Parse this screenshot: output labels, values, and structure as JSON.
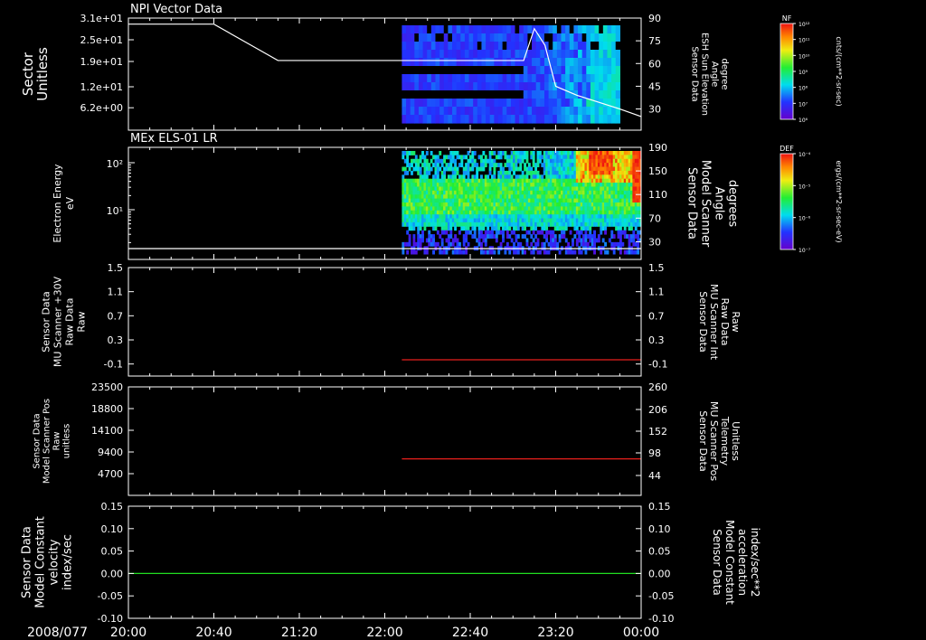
{
  "chart_data": [
    {
      "type": "heatmap",
      "title": "NPI Vector Data",
      "ylabel": [
        "Sector",
        "Unitless"
      ],
      "yticks": [
        "3.1e+01",
        "2.5e+01",
        "1.9e+01",
        "1.2e+01",
        "6.2e+00"
      ],
      "ylim": [
        0,
        31
      ],
      "y2label": [
        "Sensor Data",
        "ESH Sun Elevation",
        "Angle",
        "degree"
      ],
      "y2ticks": [
        "90",
        "75",
        "60",
        "45",
        "30"
      ],
      "y2lim": [
        16,
        90
      ],
      "line_series": {
        "x": [
          "20:00",
          "20:40",
          "21:00",
          "21:10",
          "22:00",
          "22:40",
          "23:05",
          "23:10",
          "23:15",
          "23:20",
          "23:30",
          "23:50",
          "00:00"
        ],
        "y": [
          86,
          86,
          70,
          62,
          62,
          62,
          62,
          83,
          72,
          45,
          39,
          30,
          25
        ]
      },
      "data_start": "22:08",
      "colorbar": {
        "label": "NF",
        "units": "cnts/(cm**2-sr-sec)",
        "ticks": [
          "10¹²",
          "10¹¹",
          "10¹⁰",
          "10⁹",
          "10⁸",
          "10⁷",
          "10⁶"
        ]
      }
    },
    {
      "type": "heatmap",
      "title": "MEx ELS-01 LR",
      "ylabel": [
        "Electron Energy",
        "eV"
      ],
      "yticks": [
        "10²",
        "10¹"
      ],
      "y2label": [
        "Sensor Data",
        "Model Scanner",
        "Angle",
        "degrees"
      ],
      "y2ticks": [
        "190",
        "150",
        "110",
        "70",
        "30"
      ],
      "y2lim": [
        0,
        190
      ],
      "line_series": {
        "x": [
          "20:00",
          "00:00"
        ],
        "y": [
          0,
          0
        ]
      },
      "data_start": "22:08",
      "colorbar": {
        "label": "DEF",
        "units": "ergs/(cm**2-sr-sec-eV)",
        "ticks": [
          "10⁻⁴",
          "10⁻⁵",
          "10⁻⁶",
          "10⁻⁷"
        ]
      }
    },
    {
      "type": "line",
      "ylabel": [
        "Sensor Data",
        "MU Scanner +30V",
        "Raw Data",
        "Raw"
      ],
      "yticks": [
        "1.5",
        "1.1",
        "0.7",
        "0.3",
        "-0.1"
      ],
      "ylim": [
        -0.3,
        1.5
      ],
      "y2label": [
        "Sensor Data",
        "MU Scanner Int",
        "Raw Data",
        "Raw"
      ],
      "y2ticks": [
        "1.5",
        "1.1",
        "0.7",
        "0.3",
        "-0.1"
      ],
      "series": [
        {
          "color": "#e8201c",
          "x": [
            "22:08",
            "00:00"
          ],
          "y": [
            -0.03,
            -0.03
          ]
        }
      ]
    },
    {
      "type": "line",
      "ylabel": [
        "Sensor Data",
        "Model Scanner Pos",
        "Raw",
        "unitless"
      ],
      "yticks": [
        "23500",
        "18800",
        "14100",
        "9400",
        "4700"
      ],
      "ylim": [
        0,
        23500
      ],
      "y2label": [
        "Sensor Data",
        "MU Scanner Pos",
        "Telemetry",
        "Unitless"
      ],
      "y2ticks": [
        "260",
        "206",
        "152",
        "98",
        "44"
      ],
      "series": [
        {
          "color": "#e8201c",
          "x": [
            "22:08",
            "00:00"
          ],
          "y": [
            7900,
            7900
          ]
        }
      ]
    },
    {
      "type": "line",
      "ylabel": [
        "Sensor Data",
        "Model Constant",
        "velocity",
        "index/sec"
      ],
      "yticks": [
        "0.15",
        "0.10",
        "0.05",
        "0.00",
        "-0.05",
        "-0.10"
      ],
      "ylim": [
        -0.1,
        0.15
      ],
      "y2label": [
        "Sensor Data",
        "Model Constant",
        "acceleration",
        "index/sec**2"
      ],
      "y2ticks": [
        "0.15",
        "0.10",
        "0.05",
        "0.00",
        "-0.05",
        "-0.10"
      ],
      "series": [
        {
          "color": "#22dd22",
          "x": [
            "20:00",
            "00:00"
          ],
          "y": [
            0.0,
            0.0
          ]
        }
      ]
    }
  ],
  "xaxis": {
    "date": "2008/077",
    "ticks": [
      "20:00",
      "20:40",
      "21:20",
      "22:00",
      "22:40",
      "23:20",
      "00:00"
    ]
  },
  "colors": {
    "red_label": "#e8201c",
    "green_label": "#22dd22"
  }
}
